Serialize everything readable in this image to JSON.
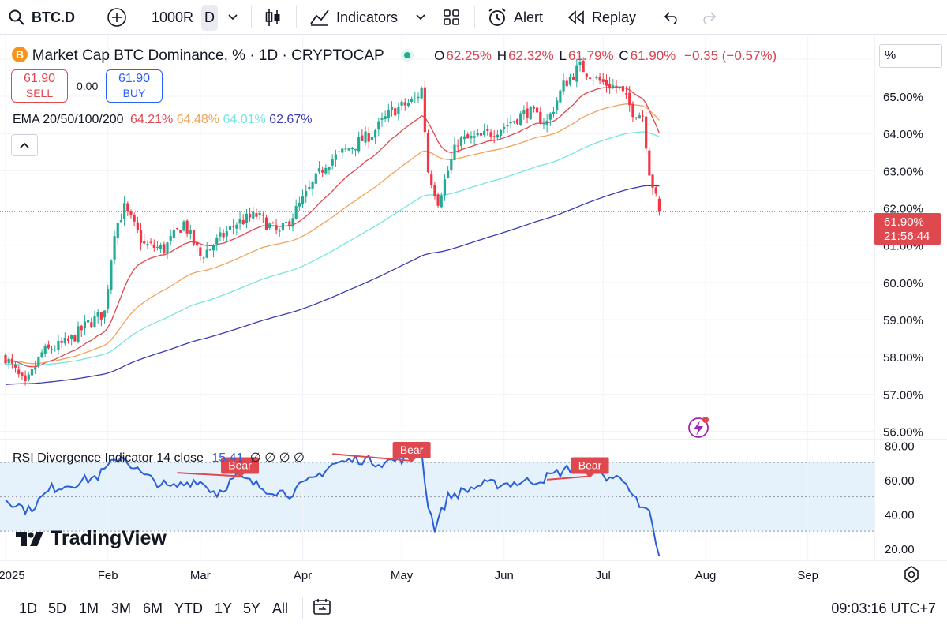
{
  "toolbar": {
    "symbol": "BTC.D",
    "interval_range": "1000R",
    "interval": "D",
    "indicators_label": "Indicators",
    "alert_label": "Alert",
    "replay_label": "Replay"
  },
  "legend": {
    "title": "Market Cap BTC Dominance, % · 1D · CRYPTOCAP",
    "o_label": "O",
    "o_value": "62.25%",
    "h_label": "H",
    "h_value": "62.32%",
    "l_label": "L",
    "l_value": "61.79%",
    "c_label": "C",
    "c_value": "61.90%",
    "change": "−0.35 (−0.57%)",
    "sell_price": "61.90",
    "sell_label": "SELL",
    "spread": "0.00",
    "buy_price": "61.90",
    "buy_label": "BUY",
    "ema_label": "EMA 20/50/100/200",
    "ema_values": [
      "64.21%",
      "64.48%",
      "64.01%",
      "62.67%"
    ],
    "rsi_label": "RSI Divergence Indicator 14 close",
    "rsi_value": "15.41",
    "rsi_na": "∅ ∅ ∅ ∅",
    "percent_toggle": "%",
    "last_price": "61.90%",
    "countdown": "21:56:44",
    "watermark": "TradingView"
  },
  "colors": {
    "up": "#22ab94",
    "down": "#f23645",
    "ema20": "#e0484f",
    "ema50": "#f0a35a",
    "ema100": "#76e4e0",
    "ema200": "#3b3bb3",
    "rsi_line": "#2b5fd9",
    "rsi_band": "#e5f2fc",
    "bear": "#e0484f"
  },
  "chart_data": [
    {
      "type": "candlestick",
      "title": "Market Cap BTC Dominance, % · 1D · CRYPTOCAP",
      "y_unit": "%",
      "ylim": [
        55.8,
        66.4
      ],
      "y_ticks": [
        "66.00%",
        "65.00%",
        "64.00%",
        "63.00%",
        "62.00%",
        "61.00%",
        "60.00%",
        "59.00%",
        "58.00%",
        "57.00%",
        "56.00%"
      ],
      "x_ticks": [
        "2025",
        "Feb",
        "Mar",
        "Apr",
        "May",
        "Jun",
        "Jul",
        "Aug",
        "Sep"
      ],
      "x_range": [
        "2025-01-01",
        "2025-09-30"
      ],
      "last_date": "2025-07-18",
      "close_anchors": [
        [
          "2025-01-01",
          58.0
        ],
        [
          "2025-01-07",
          57.2
        ],
        [
          "2025-01-12",
          58.1
        ],
        [
          "2025-01-20",
          58.4
        ],
        [
          "2025-01-26",
          58.9
        ],
        [
          "2025-01-31",
          59.2
        ],
        [
          "2025-02-03",
          61.4
        ],
        [
          "2025-02-06",
          62.0
        ],
        [
          "2025-02-12",
          61.0
        ],
        [
          "2025-02-18",
          60.9
        ],
        [
          "2025-02-24",
          61.6
        ],
        [
          "2025-03-01",
          60.7
        ],
        [
          "2025-03-06",
          61.1
        ],
        [
          "2025-03-12",
          61.6
        ],
        [
          "2025-03-18",
          61.8
        ],
        [
          "2025-03-25",
          61.3
        ],
        [
          "2025-04-01",
          62.2
        ],
        [
          "2025-04-08",
          63.2
        ],
        [
          "2025-04-15",
          63.6
        ],
        [
          "2025-04-22",
          64.0
        ],
        [
          "2025-04-28",
          64.6
        ],
        [
          "2025-05-05",
          64.9
        ],
        [
          "2025-05-07",
          65.2
        ],
        [
          "2025-05-09",
          63.0
        ],
        [
          "2025-05-12",
          62.2
        ],
        [
          "2025-05-18",
          63.8
        ],
        [
          "2025-05-25",
          63.9
        ],
        [
          "2025-06-01",
          64.2
        ],
        [
          "2025-06-08",
          64.6
        ],
        [
          "2025-06-14",
          64.3
        ],
        [
          "2025-06-19",
          65.3
        ],
        [
          "2025-06-24",
          65.8
        ],
        [
          "2025-06-30",
          65.4
        ],
        [
          "2025-07-06",
          65.2
        ],
        [
          "2025-07-10",
          64.6
        ],
        [
          "2025-07-13",
          64.5
        ],
        [
          "2025-07-15",
          63.0
        ],
        [
          "2025-07-17",
          62.25
        ],
        [
          "2025-07-18",
          61.9
        ]
      ],
      "ema_last": {
        "EMA 20": 64.21,
        "EMA 50": 64.48,
        "EMA 100": 64.01,
        "EMA 200": 62.67
      },
      "last": {
        "open": 62.25,
        "high": 62.32,
        "low": 61.79,
        "close": 61.9
      }
    },
    {
      "type": "line",
      "title": "RSI Divergence Indicator 14 close",
      "ylim": [
        14,
        82
      ],
      "y_ticks": [
        "80.00",
        "60.00",
        "40.00",
        "20.00"
      ],
      "band": [
        30,
        70
      ],
      "midline": 50,
      "anchors": [
        [
          "2025-01-01",
          49
        ],
        [
          "2025-01-08",
          42
        ],
        [
          "2025-01-15",
          55
        ],
        [
          "2025-01-22",
          58
        ],
        [
          "2025-01-29",
          62
        ],
        [
          "2025-02-05",
          74
        ],
        [
          "2025-02-12",
          62
        ],
        [
          "2025-02-20",
          55
        ],
        [
          "2025-02-28",
          60
        ],
        [
          "2025-03-06",
          52
        ],
        [
          "2025-03-12",
          62
        ],
        [
          "2025-03-20",
          55
        ],
        [
          "2025-03-28",
          52
        ],
        [
          "2025-04-04",
          60
        ],
        [
          "2025-04-10",
          69
        ],
        [
          "2025-04-18",
          72
        ],
        [
          "2025-04-25",
          70
        ],
        [
          "2025-05-01",
          72
        ],
        [
          "2025-05-07",
          76
        ],
        [
          "2025-05-09",
          45
        ],
        [
          "2025-05-11",
          32
        ],
        [
          "2025-05-15",
          50
        ],
        [
          "2025-05-25",
          57
        ],
        [
          "2025-06-04",
          58
        ],
        [
          "2025-06-12",
          60
        ],
        [
          "2025-06-20",
          66
        ],
        [
          "2025-06-25",
          70
        ],
        [
          "2025-07-01",
          62
        ],
        [
          "2025-07-08",
          60
        ],
        [
          "2025-07-12",
          43
        ],
        [
          "2025-07-15",
          40
        ],
        [
          "2025-07-18",
          15.41
        ]
      ],
      "divergences": [
        {
          "label": "Bear",
          "from": [
            "2025-02-22",
            64
          ],
          "to": [
            "2025-03-13",
            62
          ]
        },
        {
          "label": "Bear",
          "from": [
            "2025-04-10",
            75
          ],
          "to": [
            "2025-05-04",
            71
          ]
        },
        {
          "label": "Bear",
          "from": [
            "2025-06-14",
            60
          ],
          "to": [
            "2025-06-27",
            62
          ]
        }
      ]
    }
  ],
  "bottombar": {
    "ranges": [
      "1D",
      "5D",
      "1M",
      "3M",
      "6M",
      "YTD",
      "1Y",
      "5Y",
      "All"
    ],
    "clock": "09:03:16 UTC+7"
  }
}
